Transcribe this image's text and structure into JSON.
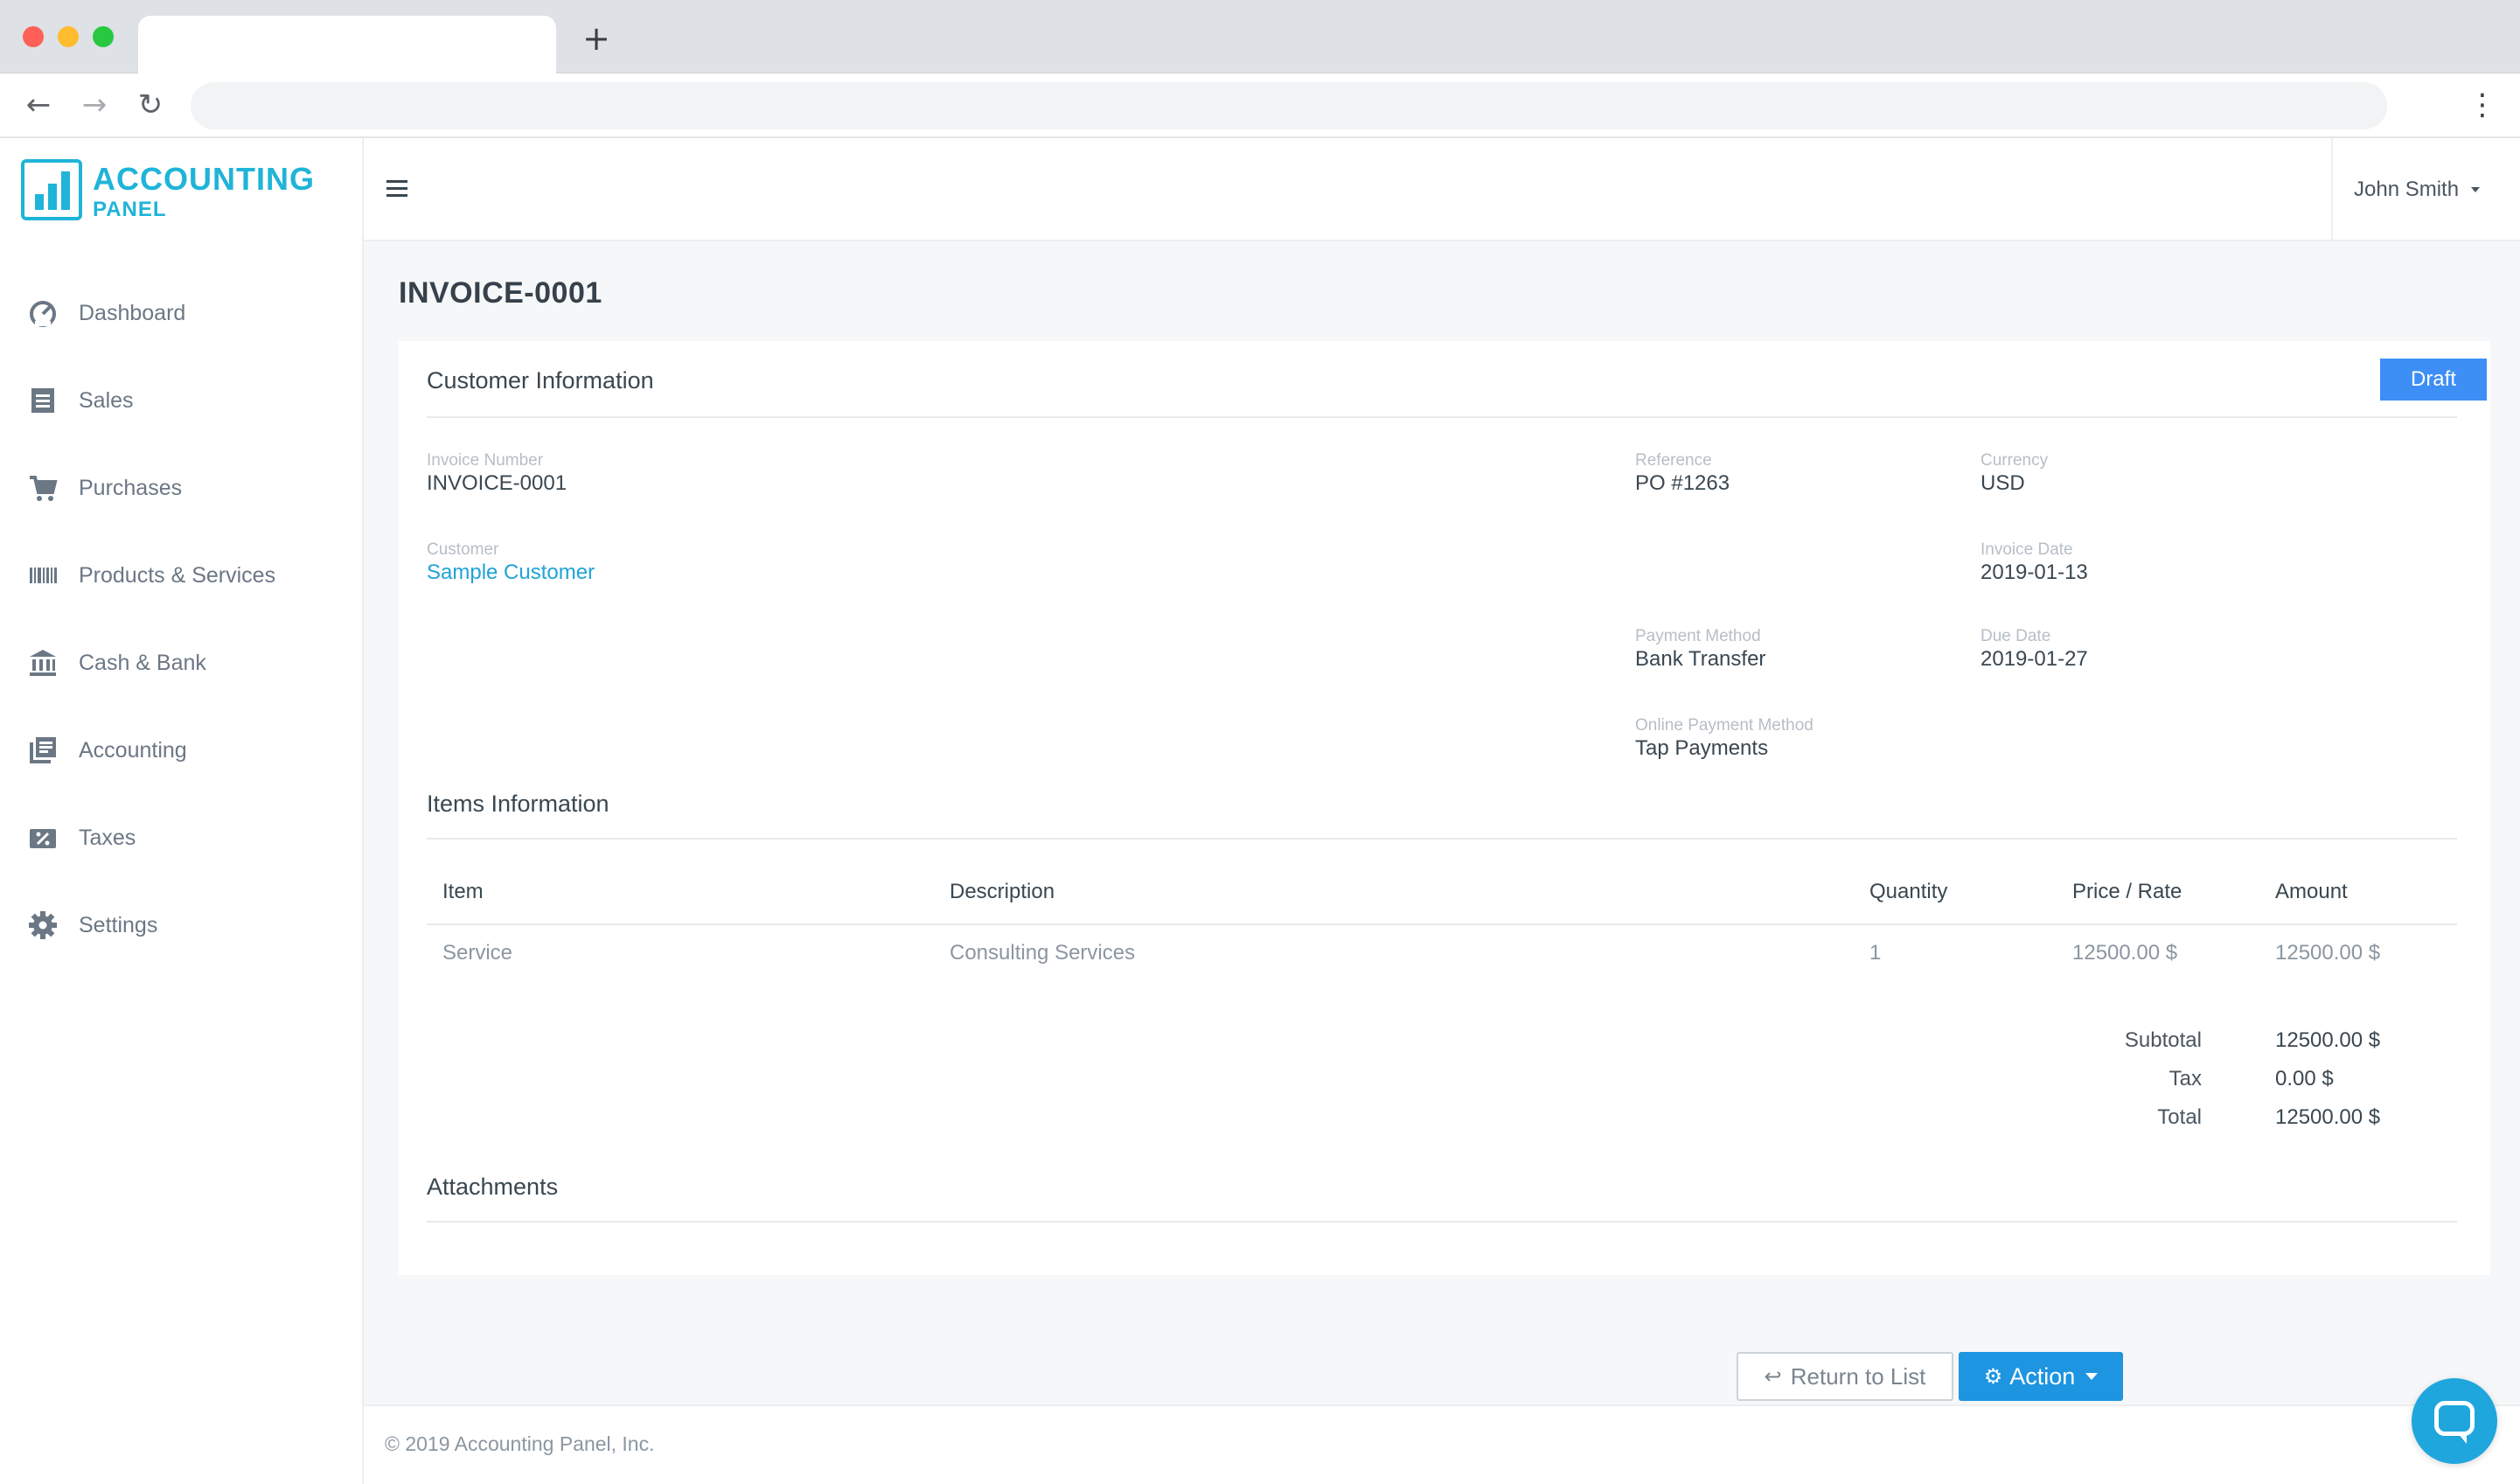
{
  "browser": {
    "new_tab_glyph": "+",
    "back_glyph": "←",
    "forward_glyph": "→",
    "reload_glyph": "↻",
    "menu_glyph": "⋮"
  },
  "brand": {
    "title": "ACCOUNTING",
    "subtitle": "PANEL",
    "accent_color": "#1fb4d8"
  },
  "sidebar": {
    "items": [
      {
        "label": "Dashboard",
        "icon": "speedometer-icon"
      },
      {
        "label": "Sales",
        "icon": "receipt-icon"
      },
      {
        "label": "Purchases",
        "icon": "cart-icon"
      },
      {
        "label": "Products & Services",
        "icon": "barcode-icon"
      },
      {
        "label": "Cash & Bank",
        "icon": "bank-icon"
      },
      {
        "label": "Accounting",
        "icon": "ledger-icon"
      },
      {
        "label": "Taxes",
        "icon": "percent-ticket-icon"
      },
      {
        "label": "Settings",
        "icon": "gear-icon"
      }
    ]
  },
  "topbar": {
    "user_name": "John Smith"
  },
  "page": {
    "title": "INVOICE-0001"
  },
  "customer_info": {
    "section_title": "Customer Information",
    "status_badge": "Draft",
    "status_color": "#3d8ef5",
    "invoice_number": {
      "label": "Invoice Number",
      "value": "INVOICE-0001"
    },
    "reference": {
      "label": "Reference",
      "value": "PO #1263"
    },
    "currency": {
      "label": "Currency",
      "value": "USD"
    },
    "customer": {
      "label": "Customer",
      "value": "Sample Customer"
    },
    "invoice_date": {
      "label": "Invoice Date",
      "value": "2019-01-13"
    },
    "payment_method": {
      "label": "Payment Method",
      "value": "Bank Transfer"
    },
    "due_date": {
      "label": "Due Date",
      "value": "2019-01-27"
    },
    "online_payment_method": {
      "label": "Online Payment Method",
      "value": "Tap Payments"
    }
  },
  "items_info": {
    "section_title": "Items Information",
    "columns": [
      "Item",
      "Description",
      "Quantity",
      "Price / Rate",
      "Amount"
    ],
    "rows": [
      [
        "Service",
        "Consulting Services",
        "1",
        "12500.00 $",
        "12500.00 $"
      ]
    ],
    "totals": {
      "subtotal_label": "Subtotal",
      "subtotal_value": "12500.00 $",
      "tax_label": "Tax",
      "tax_value": "0.00 $",
      "total_label": "Total",
      "total_value": "12500.00 $"
    }
  },
  "attachments": {
    "section_title": "Attachments"
  },
  "actions": {
    "return_label": "Return to List",
    "return_glyph": "↩",
    "action_label": "Action",
    "action_glyph": "⚙",
    "action_color": "#1d95e0"
  },
  "footer": {
    "text": "© 2019 Accounting Panel, Inc."
  }
}
